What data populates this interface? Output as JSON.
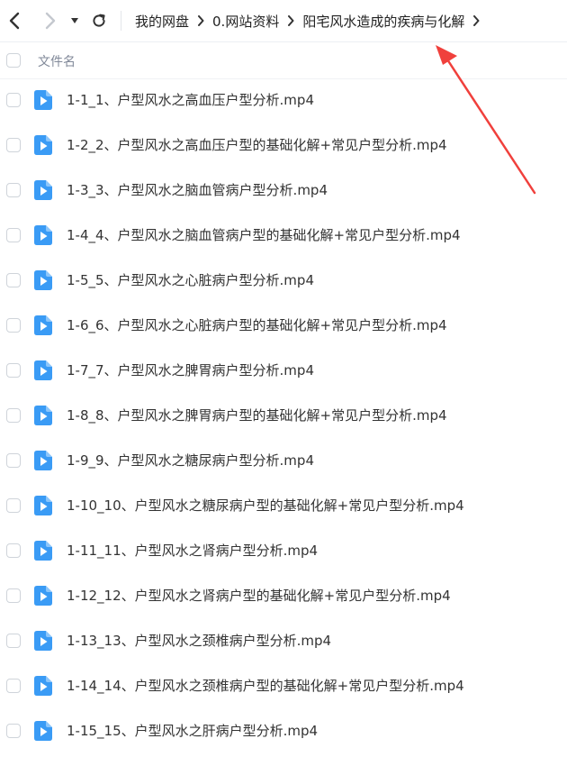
{
  "nav": {
    "back_icon": "chevron-left-icon",
    "forward_icon": "chevron-right-icon",
    "dropdown_icon": "caret-down-icon",
    "refresh_icon": "refresh-icon"
  },
  "breadcrumb": [
    "我的网盘",
    "0.网站资料",
    "阳宅风水造成的疾病与化解"
  ],
  "header": {
    "column_label": "文件名"
  },
  "files": [
    "1-1_1、户型风水之高血压户型分析.mp4",
    "1-2_2、户型风水之高血压户型的基础化解+常见户型分析.mp4",
    "1-3_3、户型风水之脑血管病户型分析.mp4",
    "1-4_4、户型风水之脑血管病户型的基础化解+常见户型分析.mp4",
    "1-5_5、户型风水之心脏病户型分析.mp4",
    "1-6_6、户型风水之心脏病户型的基础化解+常见户型分析.mp4",
    "1-7_7、户型风水之脾胃病户型分析.mp4",
    "1-8_8、户型风水之脾胃病户型的基础化解+常见户型分析.mp4",
    "1-9_9、户型风水之糖尿病户型分析.mp4",
    "1-10_10、户型风水之糖尿病户型的基础化解+常见户型分析.mp4",
    "1-11_11、户型风水之肾病户型分析.mp4",
    "1-12_12、户型风水之肾病户型的基础化解+常见户型分析.mp4",
    "1-13_13、户型风水之颈椎病户型分析.mp4",
    "1-14_14、户型风水之颈椎病户型的基础化解+常见户型分析.mp4",
    "1-15_15、户型风水之肝病户型分析.mp4"
  ],
  "file_icon": "video-file-icon",
  "colors": {
    "file_icon_bg": "#3a9bf5",
    "annotation_arrow": "#f0403c",
    "nav_active": "#333333",
    "nav_disabled": "#c4c8cf"
  }
}
